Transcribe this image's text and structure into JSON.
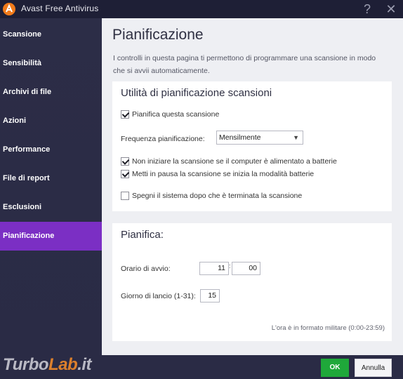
{
  "app": {
    "title": "Avast Free Antivirus",
    "help": "?",
    "close": "✕",
    "logo_icon": "avast-logo-icon",
    "accent": "#7b2fc4"
  },
  "sidebar": {
    "items": [
      {
        "label": "Scansione",
        "active": false
      },
      {
        "label": "Sensibilità",
        "active": false
      },
      {
        "label": "Archivi di file",
        "active": false
      },
      {
        "label": "Azioni",
        "active": false
      },
      {
        "label": "Performance",
        "active": false
      },
      {
        "label": "File di report",
        "active": false
      },
      {
        "label": "Esclusioni",
        "active": false
      },
      {
        "label": "Pianificazione",
        "active": true
      }
    ]
  },
  "main": {
    "title": "Pianificazione",
    "description": "I controlli in questa pagina ti permettono di programmare una scansione in modo che si avvii automaticamente.",
    "utility": {
      "title": "Utilità di pianificazione scansioni",
      "schedule_checkbox": {
        "label": "Pianifica questa scansione",
        "checked": true
      },
      "frequency_label": "Frequenza pianificazione:",
      "frequency_value": "Mensilmente",
      "battery_checkbox": {
        "label": "Non iniziare la scansione se il computer è alimentato a batterie",
        "checked": true
      },
      "pause_checkbox": {
        "label": "Metti in pausa la scansione se inizia la modalità batterie",
        "checked": true
      },
      "shutdown_checkbox": {
        "label": "Spegni il sistema dopo che è terminata la scansione",
        "checked": false
      }
    },
    "schedule": {
      "title": "Pianifica:",
      "start_time_label": "Orario di avvio:",
      "hour": "11",
      "separator": ":",
      "minute": "00",
      "day_label": "Giorno di lancio (1-31):",
      "day": "15",
      "note": "L'ora è in formato militare (0:00-23:59)"
    }
  },
  "footer": {
    "ok": "OK",
    "cancel": "Annulla",
    "ok_color": "#1fa83a",
    "watermark_part1": "Turbo",
    "watermark_part2": "Lab",
    "watermark_part3": ".it"
  }
}
